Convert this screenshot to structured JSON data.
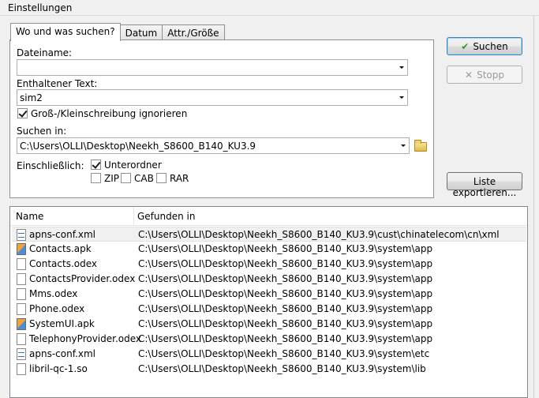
{
  "window": {
    "title": "Einstellungen"
  },
  "tabs": [
    {
      "label": "Wo und was suchen?",
      "active": true
    },
    {
      "label": "Datum",
      "active": false
    },
    {
      "label": "Attr./Größe",
      "active": false
    }
  ],
  "form": {
    "filename_label": "Dateiname:",
    "filename_value": "",
    "text_label": "Enthaltener Text:",
    "text_value": "sim2",
    "ignore_case_label": "Groß-/Kleinschreibung ignorieren",
    "ignore_case_checked": true,
    "search_in_label": "Suchen in:",
    "search_in_value": "C:\\Users\\OLLI\\Desktop\\Neekh_S8600_B140_KU3.9",
    "include_label": "Einschließlich:",
    "subfolders_label": "Unterordner",
    "subfolders_checked": true,
    "zip_label": "ZIP",
    "zip_checked": false,
    "cab_label": "CAB",
    "cab_checked": false,
    "rar_label": "RAR",
    "rar_checked": false
  },
  "buttons": {
    "search": "Suchen",
    "stop": "Stopp",
    "export": "Liste exportieren..."
  },
  "results": {
    "columns": [
      "Name",
      "Gefunden in"
    ],
    "rows": [
      {
        "name": "apns-conf.xml",
        "path": "C:\\Users\\OLLI\\Desktop\\Neekh_S8600_B140_KU3.9\\cust\\chinatelecom\\cn\\xml",
        "icon": "xml-file-icon"
      },
      {
        "name": "Contacts.apk",
        "path": "C:\\Users\\OLLI\\Desktop\\Neekh_S8600_B140_KU3.9\\system\\app",
        "icon": "apk-file-icon"
      },
      {
        "name": "Contacts.odex",
        "path": "C:\\Users\\OLLI\\Desktop\\Neekh_S8600_B140_KU3.9\\system\\app",
        "icon": "file-icon"
      },
      {
        "name": "ContactsProvider.odex",
        "path": "C:\\Users\\OLLI\\Desktop\\Neekh_S8600_B140_KU3.9\\system\\app",
        "icon": "file-icon"
      },
      {
        "name": "Mms.odex",
        "path": "C:\\Users\\OLLI\\Desktop\\Neekh_S8600_B140_KU3.9\\system\\app",
        "icon": "file-icon"
      },
      {
        "name": "Phone.odex",
        "path": "C:\\Users\\OLLI\\Desktop\\Neekh_S8600_B140_KU3.9\\system\\app",
        "icon": "file-icon"
      },
      {
        "name": "SystemUI.apk",
        "path": "C:\\Users\\OLLI\\Desktop\\Neekh_S8600_B140_KU3.9\\system\\app",
        "icon": "apk-file-icon"
      },
      {
        "name": "TelephonyProvider.odex",
        "path": "C:\\Users\\OLLI\\Desktop\\Neekh_S8600_B140_KU3.9\\system\\app",
        "icon": "file-icon"
      },
      {
        "name": "apns-conf.xml",
        "path": "C:\\Users\\OLLI\\Desktop\\Neekh_S8600_B140_KU3.9\\system\\etc",
        "icon": "xml-file-icon"
      },
      {
        "name": "libril-qc-1.so",
        "path": "C:\\Users\\OLLI\\Desktop\\Neekh_S8600_B140_KU3.9\\system\\lib",
        "icon": "file-icon"
      }
    ]
  }
}
